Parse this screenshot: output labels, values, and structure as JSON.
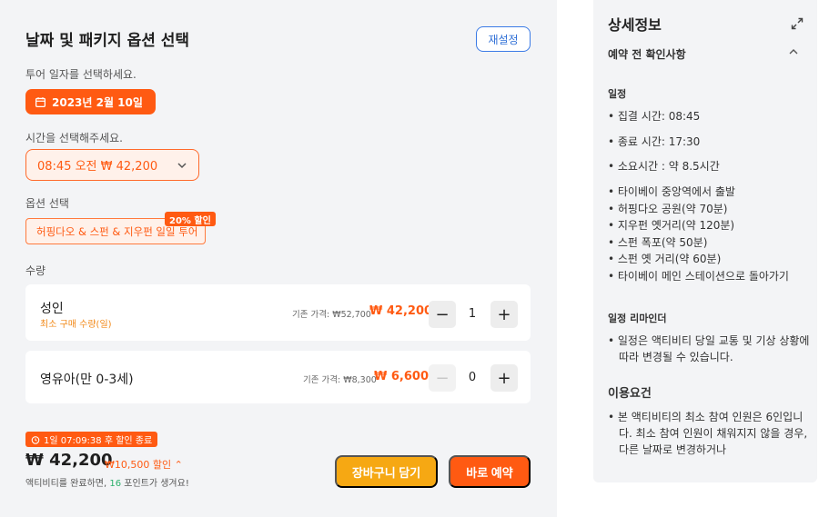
{
  "left": {
    "title": "날짜 및 패키지 옵션 선택",
    "reset_label": "재설정",
    "date_prompt": "투어 일자를 선택하세요.",
    "date_value": "2023년 2월 10일",
    "time_prompt": "시간을 선택해주세요.",
    "time_value": "08:45 오전 ₩ 42,200",
    "option_prompt": "옵션 선택",
    "option_value": "허핑다오 & 스펀 & 지우펀 일일 투어",
    "option_badge": "20% 할인",
    "quantity_label": "수량",
    "rows": [
      {
        "name": "성인",
        "sub": "최소 구매 수량(일)",
        "orig_label": "기존 가격: ₩52,700",
        "price": "₩ 42,200",
        "minus": "−",
        "qty": "1",
        "plus": "+"
      },
      {
        "name": "영유아(만 0-3세)",
        "sub": "",
        "orig_label": "기존 가격: ₩8,300",
        "price": "₩ 6,600",
        "minus": "−",
        "qty": "0",
        "plus": "+"
      }
    ],
    "timer": "1일 07:09:38 후 할인 종료",
    "total": "₩ 42,200",
    "total_discount": "₩10,500 할인 ⌃",
    "points_prefix": "액티비티를 완료하면, ",
    "points_value": "16",
    "points_suffix": " 포인트가 생겨요!",
    "cart_label": "장바구니 담기",
    "book_label": "바로 예약"
  },
  "right": {
    "title": "상세정보",
    "section": "예약 전 확인사항",
    "schedule_heading": "일정",
    "schedule_items": [
      "• 집결 시간: 08:45",
      "• 종료 시간: 17:30",
      "• 소요시간 : 약 8.5시간",
      "•  타이베이 중앙역에서 출발",
      "•  허핑다오 공원(약 70분)",
      "•  지우펀 옛거리(약 120분)",
      "•  스펀 폭포(약 50분)",
      "•  스펀 옛 거리(약 60분)",
      "•  타이베이 메인 스테이션으로 돌아가기"
    ],
    "reminder_heading": "일정 리마인더",
    "reminder_item": "• 일정은 액티비티 당일 교통 및 기상 상황에 따라 변경될 수 있습니다.",
    "terms_heading": "이용요건",
    "terms_item": "• 본 액티비티의 최소 참여 인원은 6인입니다. 최소 참여 인원이 채워지지 않을 경우, 다른 날짜로 변경하거나"
  },
  "colors": {
    "accent": "#ff5a12",
    "cart": "#f6a813",
    "link": "#2f6fd6"
  },
  "icons": [
    "calendar-icon",
    "chevron-down-icon",
    "clock-icon",
    "expand-icon",
    "chevron-up-icon"
  ]
}
